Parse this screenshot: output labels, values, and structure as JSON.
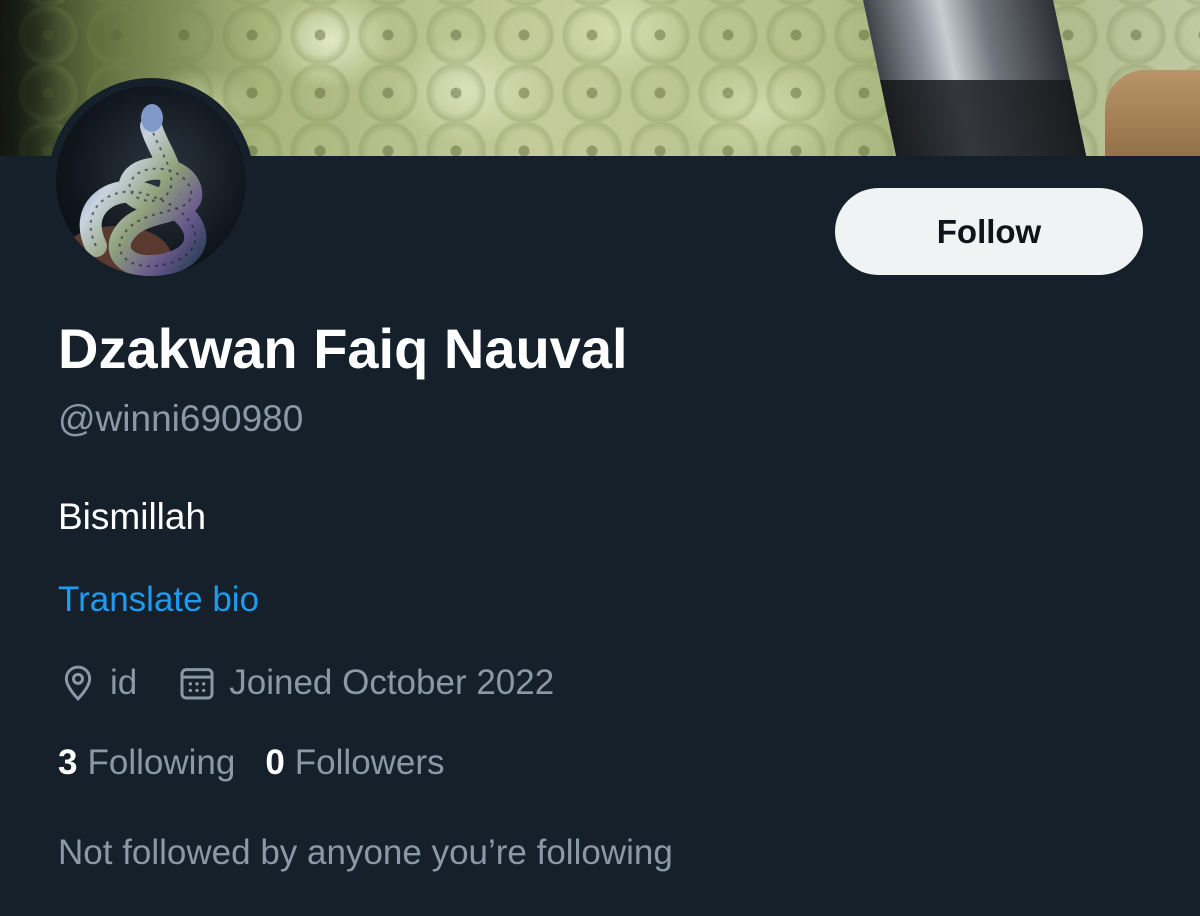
{
  "profile": {
    "display_name": "Dzakwan Faiq Nauval",
    "handle": "@winni690980",
    "bio": "Bismillah",
    "translate_bio_label": "Translate bio",
    "location": "id",
    "joined": "Joined October 2022",
    "following_count": "3",
    "following_label": "Following",
    "followers_count": "0",
    "followers_label": "Followers",
    "followed_by_text": "Not followed by anyone you’re following"
  },
  "actions": {
    "follow_label": "Follow"
  },
  "icons": {
    "location": "location-pin-icon",
    "joined": "calendar-icon"
  },
  "colors": {
    "background": "#15202b",
    "primary_text": "#ffffff",
    "secondary_text": "#8b98a5",
    "link": "#1d9bf0",
    "follow_button_bg": "#eff3f4",
    "follow_button_text": "#0f1419"
  }
}
